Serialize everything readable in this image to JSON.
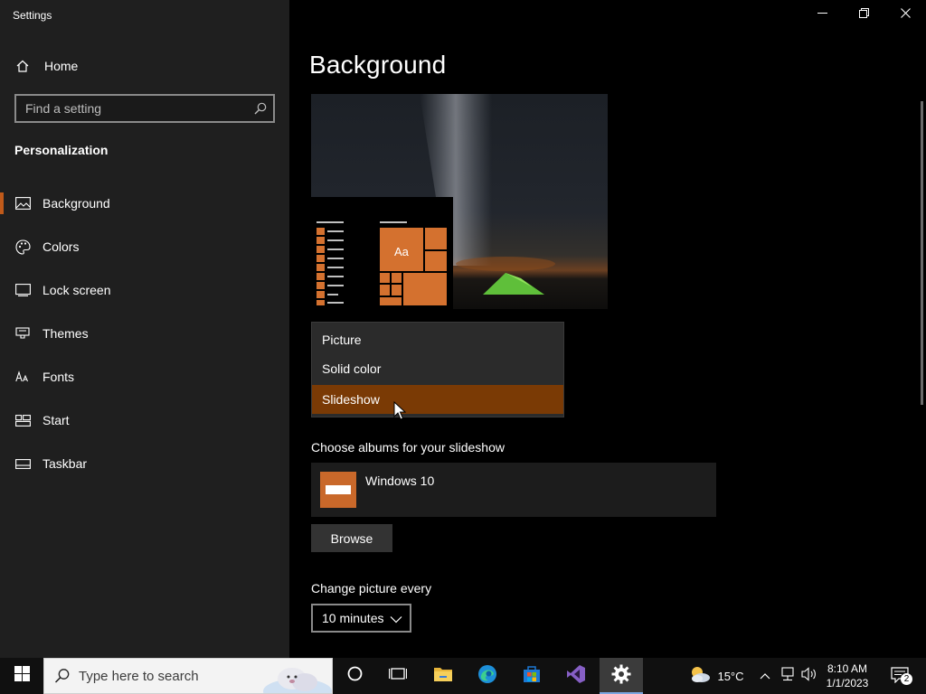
{
  "window": {
    "title": "Settings",
    "minimize_icon": "minimize-icon",
    "restore_icon": "restore-icon",
    "close_icon": "close-icon"
  },
  "sidebar": {
    "home_label": "Home",
    "search_placeholder": "Find a setting",
    "section_title": "Personalization",
    "items": [
      {
        "label": "Background",
        "icon": "image-icon",
        "selected": true
      },
      {
        "label": "Colors",
        "icon": "palette-icon"
      },
      {
        "label": "Lock screen",
        "icon": "lock-screen-icon"
      },
      {
        "label": "Themes",
        "icon": "brush-icon"
      },
      {
        "label": "Fonts",
        "icon": "font-icon"
      },
      {
        "label": "Start",
        "icon": "start-icon"
      },
      {
        "label": "Taskbar",
        "icon": "taskbar-icon"
      }
    ]
  },
  "main": {
    "title": "Background",
    "preview": {
      "tile_label": "Aa"
    },
    "background_type": {
      "options": [
        "Picture",
        "Solid color",
        "Slideshow"
      ],
      "selected": "Slideshow"
    },
    "albums_label": "Choose albums for your slideshow",
    "album_name": "Windows 10",
    "browse_label": "Browse",
    "change_picture_label": "Change picture every",
    "interval_value": "10 minutes"
  },
  "taskbar": {
    "search_placeholder": "Type here to search",
    "temperature": "15°C",
    "time": "8:10 AM",
    "date": "1/1/2023",
    "notification_count": "2"
  },
  "colors": {
    "accent": "#c05a1a",
    "selected_option": "#7a3a05",
    "sidebar_bg": "#1f1f1f",
    "main_bg": "#000000"
  }
}
